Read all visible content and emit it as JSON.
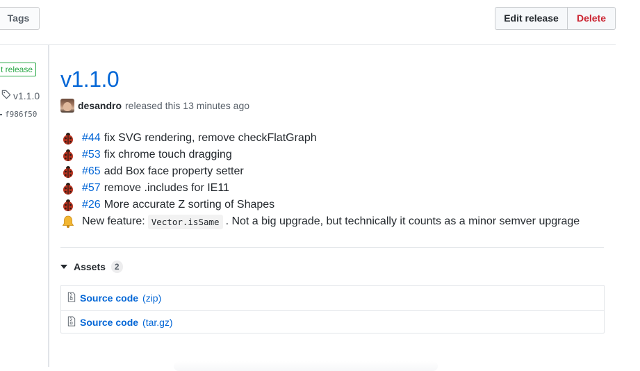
{
  "toolbar": {
    "tags_label": "Tags",
    "edit_label": "Edit release",
    "delete_label": "Delete",
    "delete_color": "#cb2431"
  },
  "sidebar": {
    "latest_label": "t release",
    "tag_name": "v1.1.0",
    "commit_sha": "f986f50",
    "tag_icon": "tag-icon",
    "commit_icon": "git-commit-icon"
  },
  "release": {
    "title": "v1.1.0",
    "author": "desandro",
    "byline": "released this 13 minutes ago",
    "title_color": "#0366d6"
  },
  "notes": [
    {
      "icon": "ladybug-icon",
      "issue": "#44",
      "text": "fix SVG rendering, remove checkFlatGraph"
    },
    {
      "icon": "ladybug-icon",
      "issue": "#53",
      "text": "fix chrome touch dragging"
    },
    {
      "icon": "ladybug-icon",
      "issue": "#65",
      "text": "add Box face property setter"
    },
    {
      "icon": "ladybug-icon",
      "issue": "#57",
      "text": "remove .includes for IE11"
    },
    {
      "icon": "ladybug-icon",
      "issue": "#26",
      "text": "More accurate Z sorting of Shapes"
    }
  ],
  "feature_note": {
    "icon": "bell-icon",
    "prefix": "New feature:",
    "code": "Vector.isSame",
    "suffix": ". Not a big upgrade, but technically it counts as a minor semver upgrage"
  },
  "assets": {
    "heading": "Assets",
    "count": "2",
    "items": [
      {
        "label": "Source code",
        "ext": "(zip)",
        "icon": "file-zip-icon"
      },
      {
        "label": "Source code",
        "ext": "(tar.gz)",
        "icon": "file-zip-icon"
      }
    ]
  }
}
